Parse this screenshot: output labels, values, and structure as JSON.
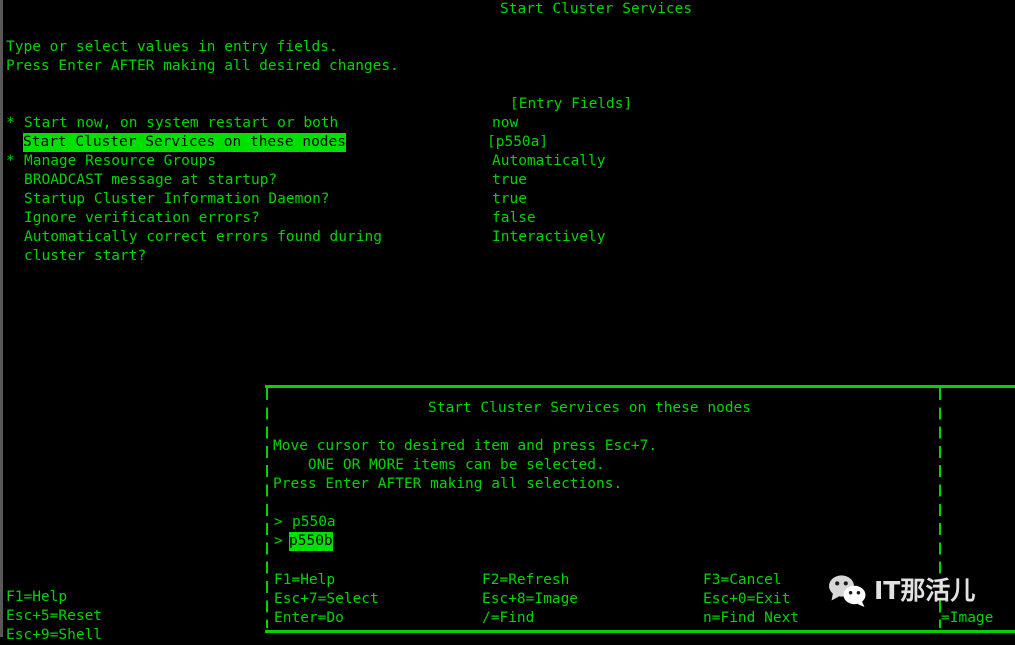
{
  "terminal": {
    "foreground_color": "#00d400",
    "background_color": "#000000",
    "highlight_bg": "#00e000",
    "highlight_fg": "#000000",
    "scrollbar_color": "#585858"
  },
  "background_screen": {
    "title": "Start Cluster Services",
    "instructions": [
      "Type or select values in entry fields.",
      "Press Enter AFTER making all desired changes."
    ],
    "entry_fields_header": "[Entry Fields]",
    "rows": [
      {
        "required_marker": "*",
        "label": "Start now, on system restart or both",
        "value": "now",
        "highlighted": false
      },
      {
        "required_marker": " ",
        "label": "Start Cluster Services on these nodes",
        "value": "[p550a]",
        "highlighted": true
      },
      {
        "required_marker": "*",
        "label": "Manage Resource Groups",
        "value": "Automatically",
        "highlighted": false
      },
      {
        "required_marker": " ",
        "label": "BROADCAST message at startup?",
        "value": "true",
        "highlighted": false
      },
      {
        "required_marker": " ",
        "label": "Startup Cluster Information Daemon?",
        "value": "true",
        "highlighted": false
      },
      {
        "required_marker": " ",
        "label": "Ignore verification errors?",
        "value": "false",
        "highlighted": false
      },
      {
        "required_marker": " ",
        "label": "Automatically correct errors found during",
        "value": "Interactively",
        "highlighted": false
      },
      {
        "required_marker": " ",
        "label": "cluster start?",
        "value": "",
        "highlighted": false
      }
    ],
    "function_keys": [
      "F1=Help",
      "Esc+5=Reset",
      "Esc+9=Shell"
    ]
  },
  "popup_dialog": {
    "title": "Start Cluster Services on these nodes",
    "instructions": [
      "Move cursor to desired item and press Esc+7.",
      "    ONE OR MORE items can be selected.",
      "Press Enter AFTER making all selections."
    ],
    "items": [
      {
        "marker": ">",
        "label": "p550a",
        "highlighted": false
      },
      {
        "marker": ">",
        "label": "p550b",
        "highlighted": true
      }
    ],
    "function_keys": {
      "column1": [
        "F1=Help",
        "Esc+7=Select",
        "Enter=Do"
      ],
      "column2": [
        "F2=Refresh",
        "Esc+8=Image",
        "/=Find"
      ],
      "column3": [
        "F3=Cancel",
        "Esc+0=Exit",
        "n=Find Next"
      ],
      "column4": [
        "",
        "",
        "=Image"
      ]
    }
  },
  "watermark": {
    "icon": "wechat-icon",
    "text": "IT那活儿",
    "color": "#e2e2e2"
  }
}
